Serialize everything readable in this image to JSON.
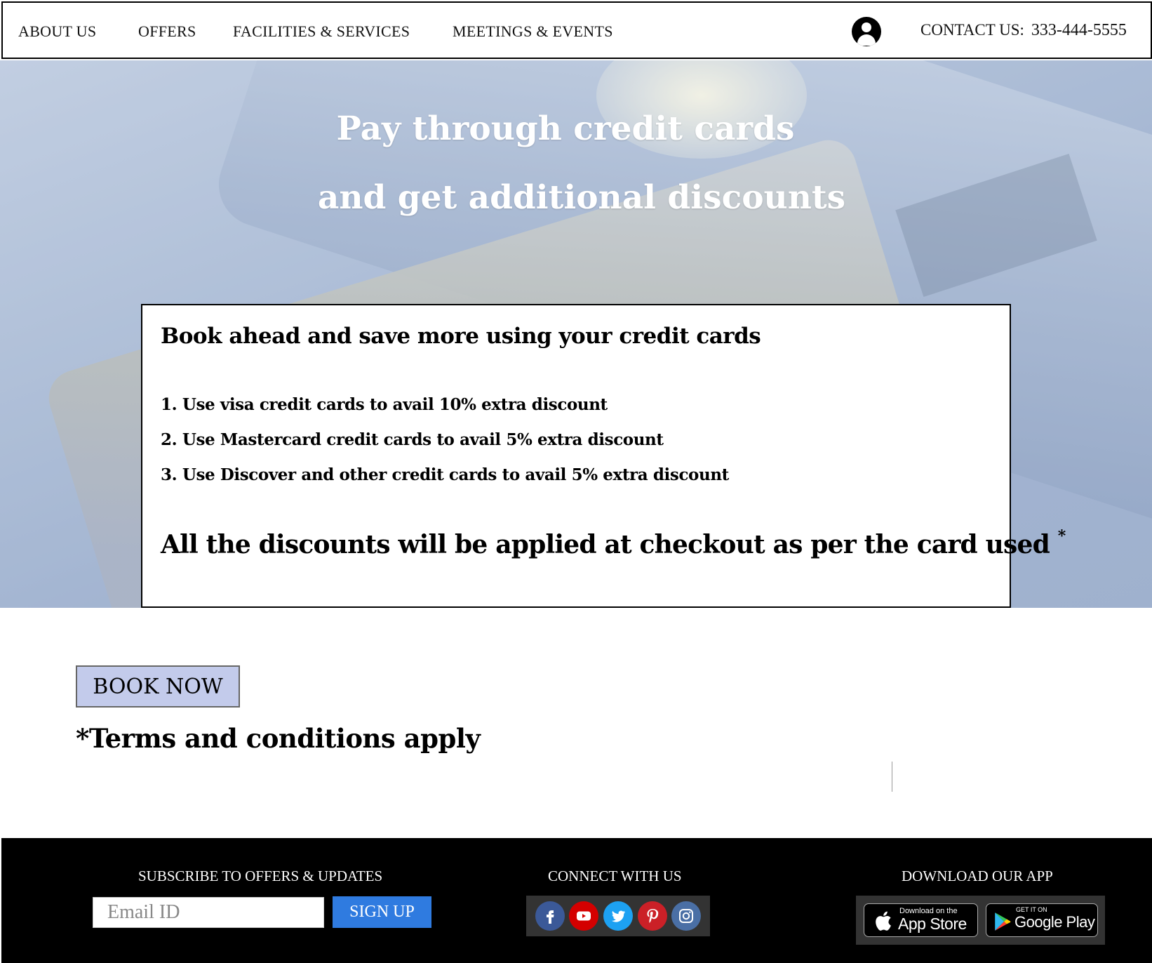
{
  "nav": {
    "items": [
      "ABOUT US",
      "OFFERS",
      "FACILITIES & SERVICES",
      "MEETINGS & EVENTS"
    ],
    "contact_label": "CONTACT US:",
    "contact_phone": "333-444-5555"
  },
  "hero": {
    "title_line1": "Pay through credit cards",
    "title_line2": "and get additional discounts"
  },
  "promo": {
    "heading": "Book ahead and save more using your credit cards",
    "items": [
      "1. Use visa credit cards to avail 10% extra discount",
      "2. Use Mastercard credit cards to avail 5% extra discount",
      "3. Use Discover and other credit cards to avail 5% extra discount"
    ],
    "note": "All the discounts will be applied at checkout as per the card used",
    "note_mark": "*"
  },
  "booking": {
    "button_label": "BOOK NOW",
    "terms": "*Terms and conditions apply"
  },
  "footer": {
    "subscribe_heading": "SUBSCRIBE TO OFFERS & UPDATES",
    "email_placeholder": "Email ID",
    "signup_label": "SIGN UP",
    "connect_heading": "CONNECT WITH US",
    "social": [
      {
        "name": "facebook-icon",
        "color": "#3b5998"
      },
      {
        "name": "youtube-icon",
        "color": "#d40000"
      },
      {
        "name": "twitter-icon",
        "color": "#1da1f2"
      },
      {
        "name": "pinterest-icon",
        "color": "#cb2027"
      },
      {
        "name": "instagram-icon",
        "color": "#4a6fa5"
      }
    ],
    "download_heading": "DOWNLOAD OUR APP",
    "app_store": {
      "small": "Download on the",
      "big": "App Store"
    },
    "google_play": {
      "small": "GET IT ON",
      "big": "Google Play"
    }
  }
}
